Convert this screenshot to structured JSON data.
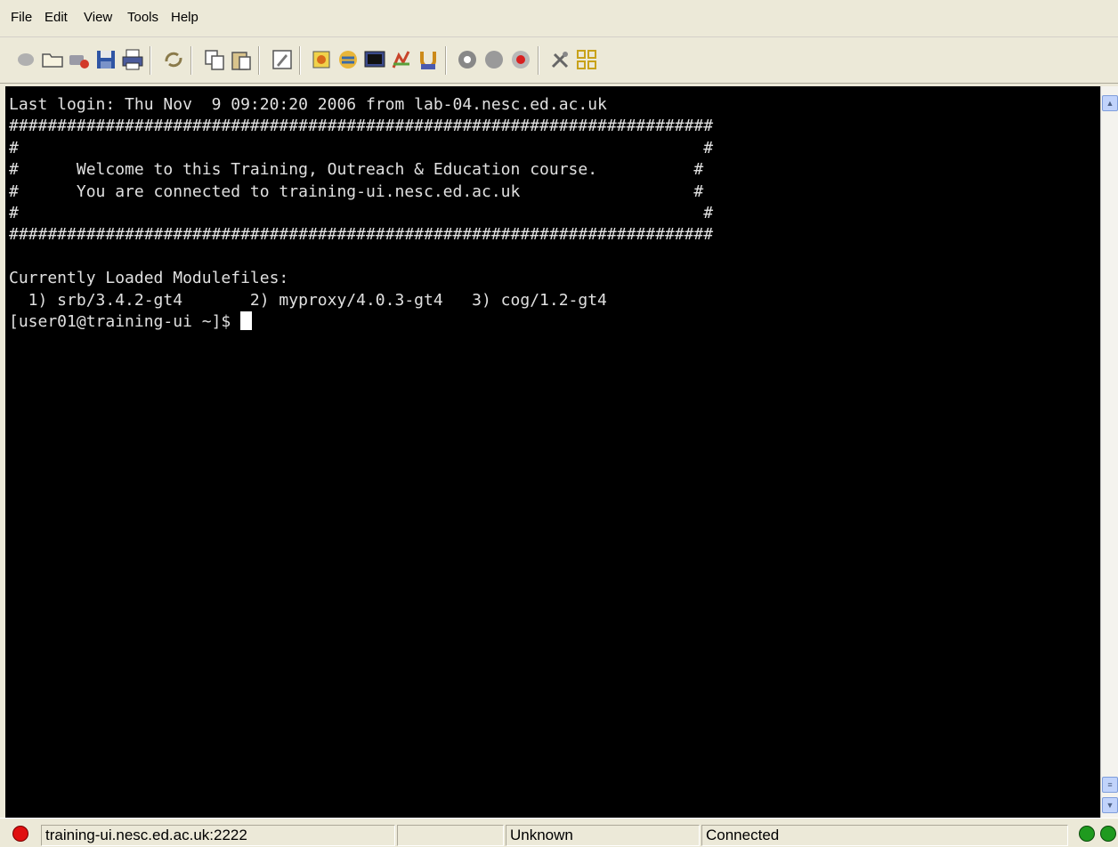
{
  "menubar": {
    "items": [
      "File",
      "Edit",
      "View",
      "Tools",
      "Help"
    ]
  },
  "toolbar": {
    "buttons": [
      "quick-connect-icon",
      "profiles-icon",
      "add-profile-icon",
      "save-icon",
      "print-icon",
      "reconnect-icon",
      "copy-icon",
      "paste-icon",
      "edit-icon",
      "keys-icon",
      "file-transfer-icon",
      "new-terminal-icon",
      "settings-icon",
      "help-icon",
      "record-icon",
      "stop-icon",
      "start-icon",
      "tools-icon",
      "network-icon"
    ]
  },
  "terminal": {
    "lines": [
      "Last login: Thu Nov  9 09:20:20 2006 from lab-04.nesc.ed.ac.uk",
      "#########################################################################",
      "#                                                                       #",
      "#      Welcome to this Training, Outreach & Education course.          #",
      "#      You are connected to training-ui.nesc.ed.ac.uk                  #",
      "#                                                                       #",
      "#########################################################################",
      "",
      "Currently Loaded Modulefiles:",
      "  1) srb/3.4.2-gt4       2) myproxy/4.0.3-gt4   3) cog/1.2-gt4"
    ],
    "prompt": "[user01@training-ui ~]$ "
  },
  "statusbar": {
    "host": "training-ui.nesc.ed.ac.uk:2222",
    "empty_panel": "",
    "encoding": "Unknown",
    "state": "Connected"
  },
  "colors": {
    "terminal_bg": "#000000",
    "terminal_fg": "#e0e0e0",
    "status_disconnected": "#e01010",
    "status_ok": "#1f9a1f"
  }
}
